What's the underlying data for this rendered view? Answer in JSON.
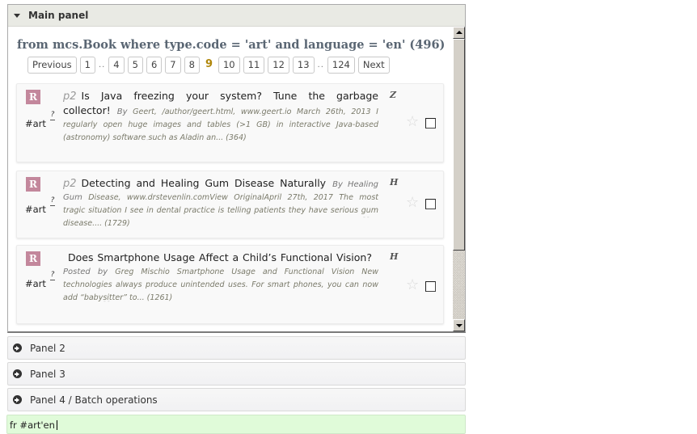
{
  "main_panel": {
    "title": "Main panel",
    "query_title": "from mcs.Book where type.code = 'art' and language = 'en' (496)",
    "pager": {
      "previous": "Previous",
      "next": "Next",
      "pages": [
        "1",
        "…",
        "4",
        "5",
        "6",
        "7",
        "8",
        "9",
        "10",
        "11",
        "12",
        "13",
        "…",
        "124"
      ],
      "current": "9"
    },
    "results": [
      {
        "badge": "R",
        "tag": "#art",
        "qmark": "?",
        "page": "p2",
        "title": "Is Java freezing your system? Tune the garbage collector!",
        "by": "By",
        "snippet": "Geert, /author/geert.html, www.geert.io March 26th, 2013 I regularly open huge images and tables (>1 GB) in interactive Java-based (astronomy) software such as Aladin an... (364)",
        "letter": "Z",
        "starred": false,
        "checked": false
      },
      {
        "badge": "R",
        "tag": "#art",
        "qmark": "?",
        "page": "p2",
        "title": "Detecting and Healing Gum Disease Naturally",
        "by": "By Healing Gum",
        "snippet": "Disease, www.drstevenlin.comView OriginalApril 27th, 2017 The most tragic situation I see in dental practice is telling patients they have serious gum disease.... (1729)",
        "letter": "H",
        "starred": false,
        "checked": false
      },
      {
        "badge": "R",
        "tag": "#art",
        "qmark": "?",
        "page": "",
        "title": "Does Smartphone Usage Affect a Child’s Functional Vision?",
        "by": "Posted by",
        "snippet": "Greg Mischio Smartphone Usage and Functional Vision New technologies always produce unintended uses. For smart phones, you can now add “babysitter” to... (1261)",
        "letter": "H",
        "starred": false,
        "checked": false
      }
    ]
  },
  "panels": [
    {
      "label": "Panel 2"
    },
    {
      "label": "Panel 3"
    },
    {
      "label": "Panel 4 / Batch operations"
    }
  ],
  "command_input": {
    "value": "fr #art'en"
  },
  "colors": {
    "badge": "#c3879c",
    "current_page": "#b0870c",
    "command_bg": "#e0fbd9",
    "header_bg": "#e9eae4"
  }
}
